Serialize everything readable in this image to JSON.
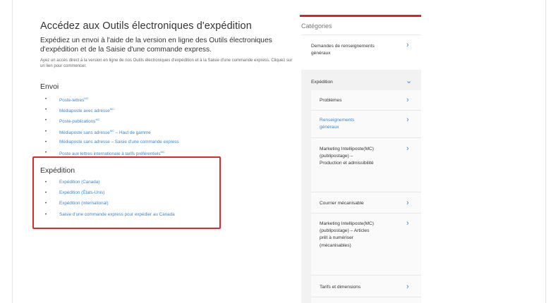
{
  "main": {
    "title": "Accédez aux Outils électroniques d'expédition",
    "lead": "Expédiez un envoi à l'aide de la version en ligne des Outils électroniques d'expédition et de la Saisie d'une commande express.",
    "small": "Ayez un accès direct à la version en ligne de nos Outils électroniques d'expédition et à la Saisie d'une commande express. Cliquez sur un lien pour commencer."
  },
  "envoi": {
    "heading": "Envoi",
    "links": [
      {
        "label": "Poste-lettres",
        "sup": "MC"
      },
      {
        "label": "Médiaposte avec adresse",
        "sup": "MC"
      },
      {
        "label": "Poste-publications",
        "sup": "MC"
      },
      {
        "label": "Médiaposte sans adresse",
        "sup": "MC",
        "suffix": " – Haut de gamme"
      },
      {
        "label": "Médiaposte sans adresse – Saisie d'une commande express",
        "sup": ""
      },
      {
        "label": "Poste aux lettres internationale à tarifs préférentiels",
        "sup": "MC"
      }
    ]
  },
  "expedition": {
    "heading": "Expédition",
    "links": [
      {
        "label": "Expédition (Canada)"
      },
      {
        "label": "Expédition (États-Unis)"
      },
      {
        "label": "Expédition (international)"
      },
      {
        "label": "Saisie d'une commande express pour expédier au Canada"
      }
    ]
  },
  "sidebar": {
    "title": "Catégories",
    "items": [
      {
        "label": "Demandes de renseignements généraux"
      },
      {
        "label": "Expédition"
      }
    ],
    "subitems": [
      {
        "label": "Problèmes"
      },
      {
        "label": "Renseignements généraux"
      },
      {
        "label": "Marketing Intelliposte(MC) (publipostage) – Production et admissibilité"
      },
      {
        "label": "Courrier mécanisable"
      },
      {
        "label": "Marketing Intelliposte(MC) (publipostage) – Articles prêt à numériser (mécanisables)"
      },
      {
        "label": "Tarifs et dimensions"
      }
    ]
  },
  "bullet": "•",
  "icons": {
    "chevron_right": "›",
    "chevron_down": "⌄"
  },
  "colors": {
    "accent_red": "#e41c23",
    "link_blue": "#3e86cf",
    "highlight": "#e4252a"
  }
}
